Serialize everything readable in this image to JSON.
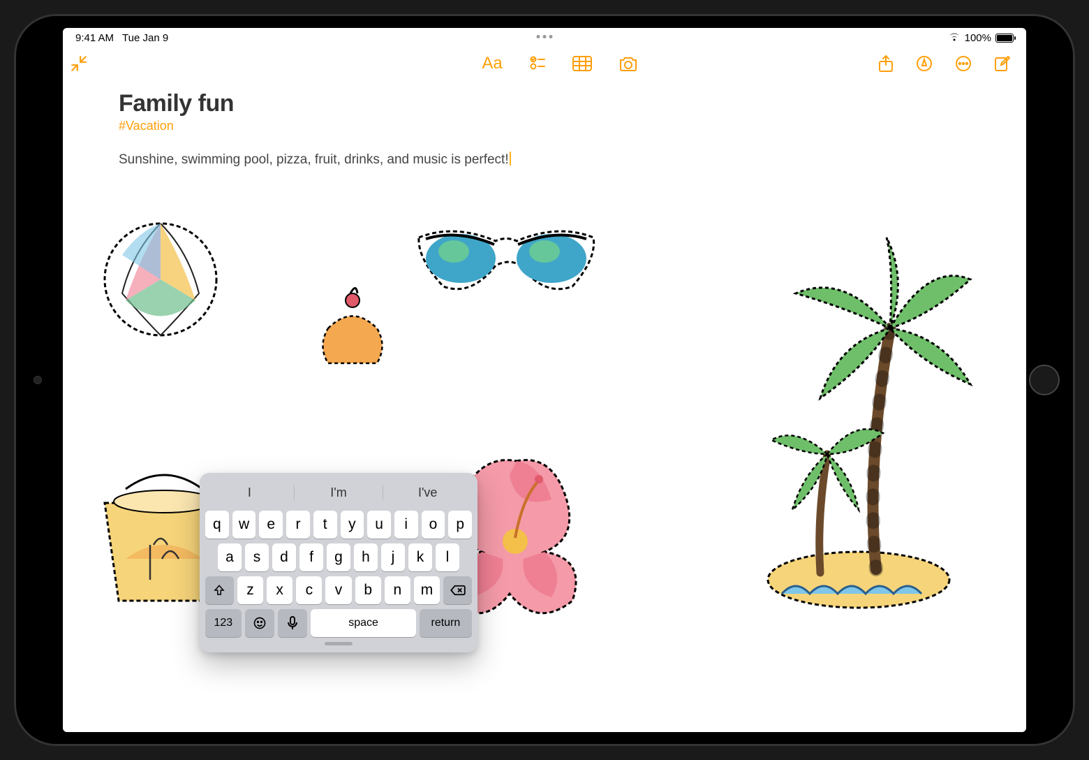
{
  "status": {
    "time": "9:41 AM",
    "date": "Tue Jan 9",
    "battery": "100%"
  },
  "toolbar": {
    "format_label": "Aa"
  },
  "note": {
    "title": "Family fun",
    "tag": "#Vacation",
    "body": "Sunshine, swimming pool, pizza, fruit, drinks, and music is perfect!"
  },
  "keyboard": {
    "suggestions": [
      "I",
      "I'm",
      "I've"
    ],
    "row1": [
      "q",
      "w",
      "e",
      "r",
      "t",
      "y",
      "u",
      "i",
      "o",
      "p"
    ],
    "row2": [
      "a",
      "s",
      "d",
      "f",
      "g",
      "h",
      "j",
      "k",
      "l"
    ],
    "row3": [
      "z",
      "x",
      "c",
      "v",
      "b",
      "n",
      "m"
    ],
    "numbers_label": "123",
    "space_label": "space",
    "return_label": "return"
  },
  "sketches": [
    "beach-ball",
    "sunglasses",
    "cupcake",
    "beach-bag",
    "hibiscus-flower",
    "palm-tree-island"
  ]
}
